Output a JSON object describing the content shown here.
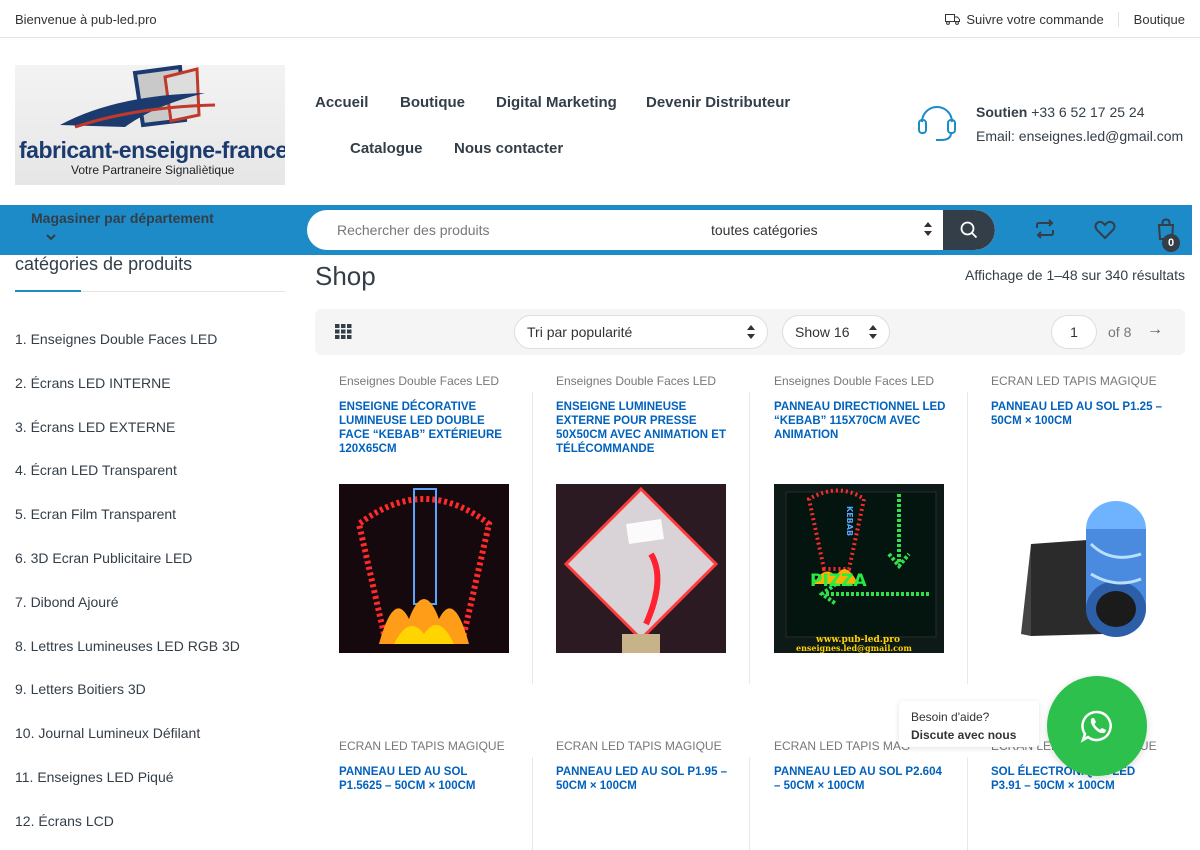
{
  "topbar": {
    "welcome": "Bienvenue à pub-led.pro",
    "track_order": "Suivre votre commande",
    "shop": "Boutique"
  },
  "logo": {
    "brand": "fabricant-enseigne-france.fr",
    "tagline": "Votre Partraneire Signalìètique"
  },
  "nav": {
    "items": [
      "Accueil",
      "Boutique",
      "Digital Marketing",
      "Devenir Distributeur",
      "Catalogue",
      "Nous contacter"
    ]
  },
  "support": {
    "label": "Soutien",
    "phone": "+33 6 52 17 25 24",
    "email": "Email: enseignes.led@gmail.com"
  },
  "bar": {
    "department": "Magasiner par département",
    "search_placeholder": "Rechercher des produits",
    "category_select": "toutes catégories",
    "cart_count": "0"
  },
  "sidebar": {
    "title": "catégories de produits",
    "categories": [
      "1. Enseignes Double Faces LED",
      "2. Écrans LED INTERNE",
      "3. Écrans LED EXTERNE",
      "4. Écran LED Transparent",
      "5. Ecran Film Transparent",
      "6. 3D Ecran Publicitaire LED",
      "7. Dibond Ajouré",
      "8. Lettres Lumineuses LED RGB 3D",
      "9. Letters Boitiers 3D",
      "10. Journal Lumineux Défilant",
      "11. Enseignes LED Piqué",
      "12. Écrans LCD"
    ]
  },
  "shop": {
    "title": "Shop",
    "results": "Affichage de 1–48 sur 340 résultats",
    "sort": "Tri par popularité",
    "show": "Show 16",
    "page": "1",
    "of": "of 8",
    "next": "→"
  },
  "products": [
    {
      "category": "Enseignes Double Faces LED",
      "name": "ENSEIGNE DÉCORATIVE LUMINEUSE LED DOUBLE FACE “KEBAB” EXTÉRIEURE 120X65cm",
      "image_icon": "kebab-sign-image"
    },
    {
      "category": "Enseignes Double Faces LED",
      "name": "ENSEIGNE LUMINEUSE EXTERNE POUR PRESSE 50X50CM AVEC ANIMATION ET TÉLÉCOMMANDE",
      "image_icon": "presse-sign-image"
    },
    {
      "category": "Enseignes Double Faces LED",
      "name": "PANNEAU DIRECTIONNEL LED “KEBAB” 115X70cm AVEC ANIMATION",
      "image_icon": "kebab-pizza-sign-image",
      "image_text": "PIZZA",
      "image_text2": "KEBAB",
      "image_url": "www.pub-led.pro",
      "image_email": "enseignes.led@gmail.com"
    },
    {
      "category": "ECRAN LED TAPIS MAGIQUE",
      "name": "PANNEAU LED AU SOL P1.25 – 50cm × 100cm",
      "image_icon": "led-floor-panel-image"
    },
    {
      "category": "ECRAN LED TAPIS MAGIQUE",
      "name": "PANNEAU LED AU SOL P1.5625 – 50cm × 100cm"
    },
    {
      "category": "ECRAN LED TAPIS MAGIQUE",
      "name": "PANNEAU LED AU SOL P1.95 – 50cm × 100cm"
    },
    {
      "category": "ECRAN LED TAPIS MAG",
      "name": "PANNEAU LED AU SOL P2.604 – 50cm × 100cm"
    },
    {
      "category": "ECRAN LED TAPIS MAGIQUE",
      "name": "SOL ÉLECTRONIQUE LED P3.91 – 50cm × 100cm"
    }
  ],
  "whatsapp": {
    "line1": "Besoin d'aide?",
    "line2": "Discute avec nous"
  },
  "colors": {
    "accent_blue": "#1d8bc8",
    "dark": "#333e48",
    "link_blue": "#0062bd",
    "whatsapp_green": "#2ec04d"
  }
}
